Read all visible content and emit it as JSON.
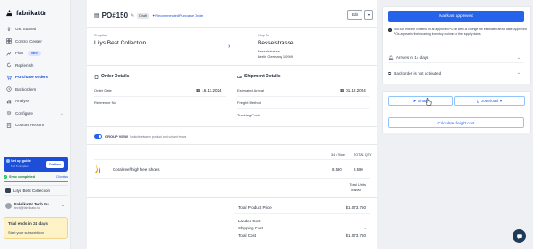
{
  "app": {
    "name": "fabrikatör"
  },
  "sidebar": {
    "items": [
      {
        "label": "Get Started",
        "icon": "rocket-icon"
      },
      {
        "label": "Control Center",
        "icon": "grid-icon"
      },
      {
        "label": "Plan",
        "icon": "chart-icon",
        "badge": "NEW"
      },
      {
        "label": "Replenish",
        "icon": "refresh-icon"
      },
      {
        "label": "Purchase Orders",
        "icon": "cart-icon",
        "active": true
      },
      {
        "label": "Backorders",
        "icon": "clock-icon"
      },
      {
        "label": "Analyse",
        "icon": "bars-icon"
      },
      {
        "label": "Configure",
        "icon": "gear-icon"
      },
      {
        "label": "Custom Reports",
        "icon": "report-icon"
      }
    ],
    "setup": {
      "title": "Set up guide",
      "subtitle": "5 of 5 complete",
      "button": "Continue"
    },
    "sync": {
      "label": "Sync completed",
      "dismiss": "Dismiss",
      "progress": 1.0
    },
    "company": "Lilys Best Collection",
    "user": {
      "name": "Fabrikatör Tech Su...",
      "email": "tech@fabrikator.io"
    },
    "trial": {
      "title": "Trial ends in 24 days",
      "link": "Start your subscription"
    }
  },
  "po": {
    "number": "PO#150",
    "status": "Draft",
    "tag": "Recommended Purchase Order",
    "edit_label": "Edit",
    "supplier_label": "Supplier",
    "supplier_name": "Lilys Best Collection",
    "ship_label": "Ship To",
    "ship_name": "Besselstrasse",
    "ship_lines": [
      "Besselstrasse",
      "Berlin Germany 10969"
    ],
    "order_details": {
      "title": "Order Details",
      "order_date_label": "Order Date",
      "order_date": "16.11.2024",
      "ref_label": "Reference No"
    },
    "shipment_details": {
      "title": "Shipment Details",
      "arrival_label": "Estimated Arrival",
      "arrival": "01.12.2024",
      "freight_label": "Freight Method",
      "tracking_label": "Tracking Code"
    },
    "group_view": {
      "label": "GROUP VIEW",
      "desc": "Switch between product and variant views"
    },
    "table": {
      "col_variant": "34 / Blue",
      "col_total": "TOTAL QTY",
      "product_name": "Coral reef high heel shoes",
      "qty": "8.590",
      "total_qty": "8.590",
      "total_units_label": "Total Units",
      "total_units": "8.590"
    },
    "summary": [
      {
        "label": "Total Product Price",
        "value": "$1.073.750"
      },
      {
        "label": "Landed Cost",
        "value": "-"
      },
      {
        "label": "Shipping Cost",
        "value": "-"
      },
      {
        "label": "Total Cost",
        "value": "$1.073.750"
      }
    ]
  },
  "right_panel": {
    "approve_label": "Mark as approved",
    "info_text": "You can edit the contents of an approved PO as well as change the estimated arrive date. Approved POs appear in the incoming inventory column of the supply plans.",
    "arrives_label": "Arrives in 14 days",
    "backorder_label": "Backorder is not activated",
    "share_label": "Share",
    "download_label": "Download",
    "freight_label": "Calculate freight cost"
  },
  "colors": {
    "accent": "#2563eb",
    "trial_bg": "#fef3c7",
    "sync": "#22c55e"
  }
}
